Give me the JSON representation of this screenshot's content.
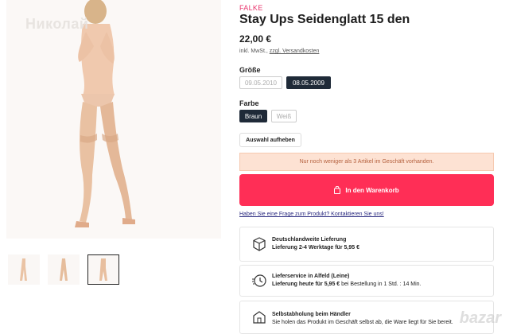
{
  "gallery": {
    "watermark_top": "Николай",
    "thumbnails": [
      "thumb-1",
      "thumb-2",
      "thumb-3"
    ]
  },
  "product": {
    "brand": "FALKE",
    "title": "Stay Ups Seidenglatt 15 den",
    "price": "22,00 €",
    "tax_prefix": "inkl. MwSt., ",
    "tax_link": "zzgl. Versandkosten"
  },
  "size": {
    "label": "Größe",
    "options": [
      {
        "label": "09.05.2010",
        "selected": false
      },
      {
        "label": "08.05.2009",
        "selected": true
      }
    ]
  },
  "color": {
    "label": "Farbe",
    "options": [
      {
        "label": "Braun",
        "selected": true
      },
      {
        "label": "Weiß",
        "selected": false
      }
    ]
  },
  "reset_label": "Auswahl aufheben",
  "notice": "Nur noch weniger als 3 Artikel im Geschäft vorhanden.",
  "cart_label": "In den Warenkorb",
  "question_link": "Haben Sie eine Frage zum Produkt? Kontaktieren Sie uns!",
  "delivery": [
    {
      "icon": "package-icon",
      "title": "Deutschlandweite Lieferung",
      "line2": "Lieferung 2-4 Werktage für 5,95 €",
      "line2_rest": ""
    },
    {
      "icon": "fast-clock-icon",
      "title": "Lieferservice in Alfeld (Leine)",
      "line2": "Lieferung heute für 5,95 €",
      "line2_rest": " bei Bestellung in 1 Std. : 14 Min."
    },
    {
      "icon": "store-pickup-icon",
      "title": "Selbstabholung beim Händler",
      "line2": "",
      "line2_rest": "Sie holen das Produkt im Geschäft selbst ab, die Ware liegt für Sie bereit."
    }
  ],
  "watermark_bottom": "bazar",
  "colors": {
    "brand_pink": "#e8336b",
    "cart_red": "#ff2e56",
    "selected_dark": "#1f2a38",
    "notice_bg": "#fde2d3"
  }
}
